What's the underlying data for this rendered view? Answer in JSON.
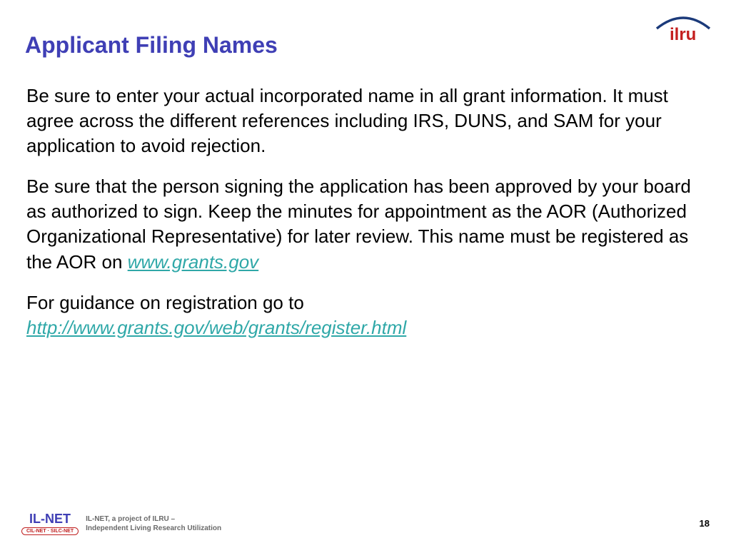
{
  "title": "Applicant Filing Names",
  "logo": {
    "text": "ilru",
    "arc_color": "#1b3a7a",
    "text_color": "#c41e1e"
  },
  "paragraphs": {
    "p1": "Be sure to enter your actual incorporated name in all grant information. It must agree across the different references including IRS, DUNS, and SAM for your application to avoid rejection.",
    "p2_a": "Be sure that the person signing the application has been approved by your board as authorized to sign. Keep the minutes for appointment as the AOR (Authorized Organizational Representative) for later review. This name must be registered as the AOR on ",
    "p2_link": "www.grants.gov",
    "p3_a": "For guidance on registration go to ",
    "p3_link": "http://www.grants.gov/web/grants/register.html"
  },
  "footer": {
    "ilnet": "IL-NET",
    "ilnet_sub": "CIL-NET · SILC-NET",
    "desc_line1": "IL-NET, a project of ILRU –",
    "desc_line2": "Independent Living Research Utilization",
    "page": "18"
  }
}
